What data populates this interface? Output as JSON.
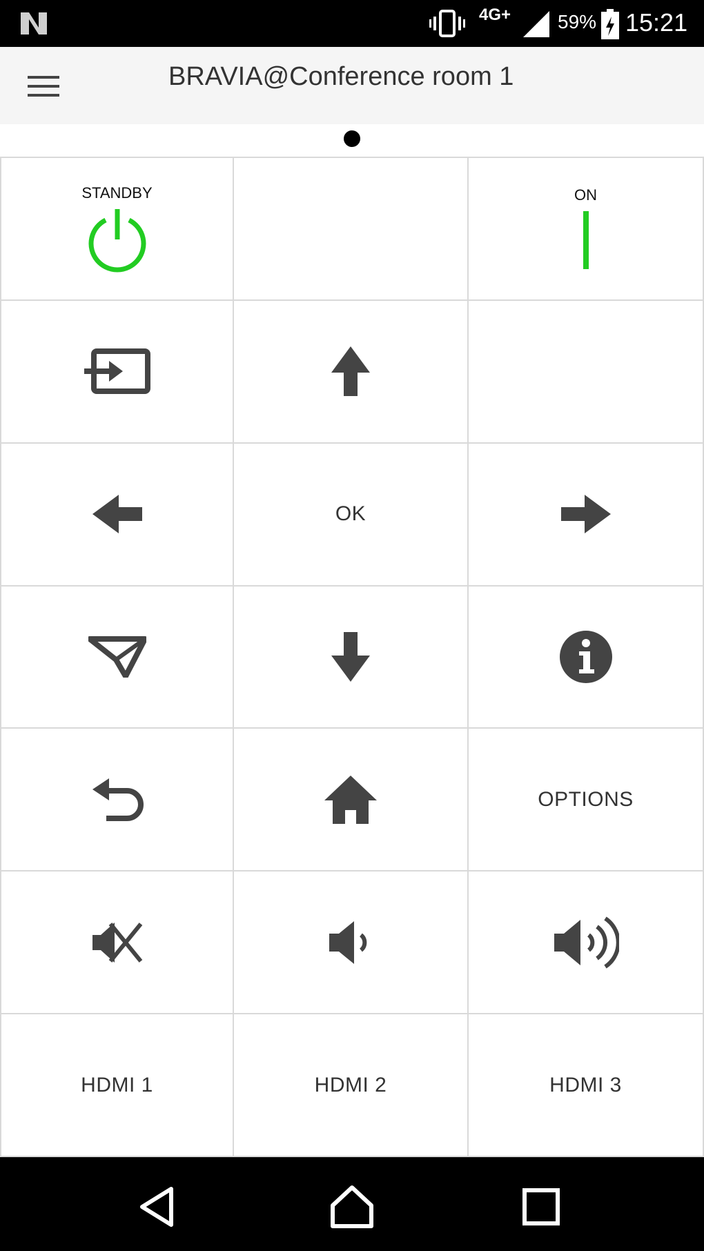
{
  "status_bar": {
    "network": "4G+",
    "battery_percent": "59%",
    "time": "15:21",
    "icons": [
      "n-logo-icon",
      "vibrate-icon",
      "signal-icon",
      "battery-charging-icon"
    ]
  },
  "app_bar": {
    "title": "BRAVIA@Conference room 1",
    "menu_icon": "hamburger-menu-icon"
  },
  "pager": {
    "pages": 1,
    "current": 1
  },
  "remote": {
    "standby_label": "STANDBY",
    "on_label": "ON",
    "ok_label": "OK",
    "options_label": "OPTIONS",
    "hdmi1_label": "HDMI 1",
    "hdmi2_label": "HDMI 2",
    "hdmi3_label": "HDMI 3",
    "accent_color": "#22cc22",
    "icon_color": "#444444"
  },
  "nav_bar": {
    "icons": [
      "back-triangle-icon",
      "home-nav-icon",
      "recents-square-icon"
    ]
  }
}
